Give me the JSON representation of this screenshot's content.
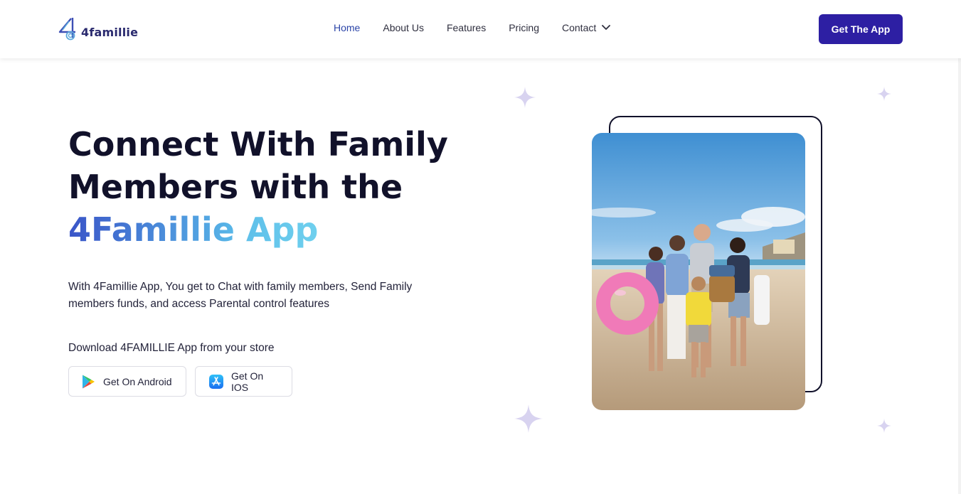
{
  "nav": {
    "logo_text": "4famillie",
    "links": [
      "Home",
      "About Us",
      "Features",
      "Pricing",
      "Contact"
    ],
    "active_link": "Home",
    "cta_label": "Get The App"
  },
  "hero": {
    "title_line1": "Connect With Family",
    "title_line2": "Members with the",
    "title_highlight_1": "4Famillie",
    "title_highlight_2": "App",
    "description": "With 4Famillie App, You get to Chat with family members, Send Family members funds, and access Parental control features",
    "download_label": "Download 4FAMILLIE App from your store",
    "android_label": "Get On Android",
    "ios_label": "Get On IOS"
  },
  "colors": {
    "brand_primary": "#2d1fa3",
    "active_nav": "#2c45a8",
    "sparkle": "#d8d3f0"
  },
  "icons": [
    "logo-icon",
    "chevron-down-icon",
    "google-play-icon",
    "app-store-icon",
    "sparkle-icon"
  ]
}
